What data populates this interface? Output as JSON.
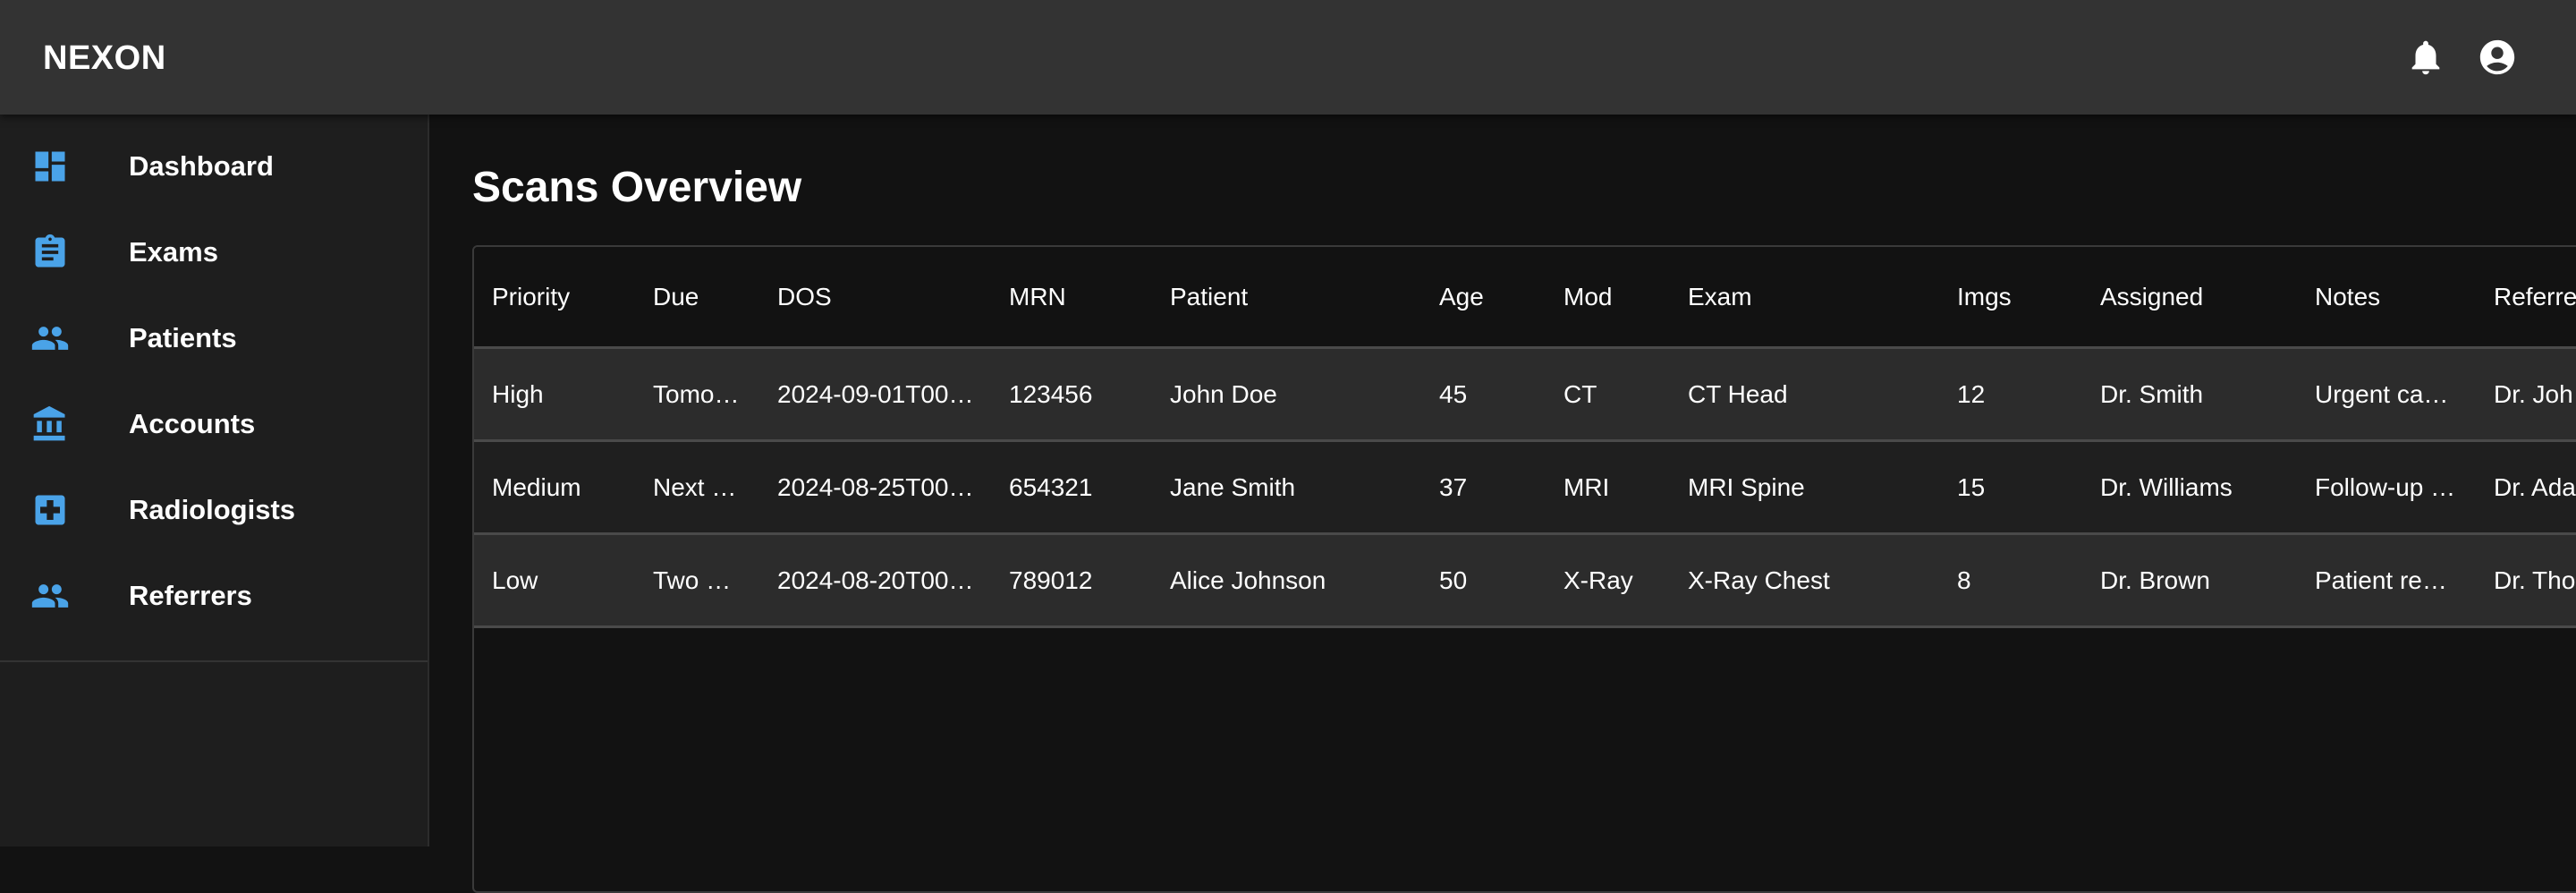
{
  "app": {
    "brand": "NEXON",
    "accent_color": "#4aa3e8",
    "appbar_icons": [
      "notifications-icon",
      "account-circle-icon"
    ]
  },
  "sidebar": {
    "items": [
      {
        "label": "Dashboard",
        "icon": "dashboard-icon"
      },
      {
        "label": "Exams",
        "icon": "assignment-icon"
      },
      {
        "label": "Patients",
        "icon": "people-icon"
      },
      {
        "label": "Accounts",
        "icon": "bank-icon"
      },
      {
        "label": "Radiologists",
        "icon": "medical-cross-icon"
      },
      {
        "label": "Referrers",
        "icon": "people-icon"
      }
    ]
  },
  "main": {
    "title": "Scans Overview",
    "table": {
      "columns": [
        "Priority",
        "Due",
        "DOS",
        "MRN",
        "Patient",
        "Age",
        "Mod",
        "Exam",
        "Imgs",
        "Assigned",
        "Notes",
        "Referrer"
      ],
      "rows": [
        [
          "High",
          "Tomo…",
          "2024-09-01T00…",
          "123456",
          "John Doe",
          "45",
          "CT",
          "CT Head",
          "12",
          "Dr. Smith",
          "Urgent ca…",
          "Dr. Joh"
        ],
        [
          "Medium",
          "Next …",
          "2024-08-25T00…",
          "654321",
          "Jane Smith",
          "37",
          "MRI",
          "MRI Spine",
          "15",
          "Dr. Williams",
          "Follow-up …",
          "Dr. Ada"
        ],
        [
          "Low",
          "Two …",
          "2024-08-20T00…",
          "789012",
          "Alice Johnson",
          "50",
          "X-Ray",
          "X-Ray Chest",
          "8",
          "Dr. Brown",
          "Patient re…",
          "Dr. Tho"
        ]
      ]
    }
  }
}
